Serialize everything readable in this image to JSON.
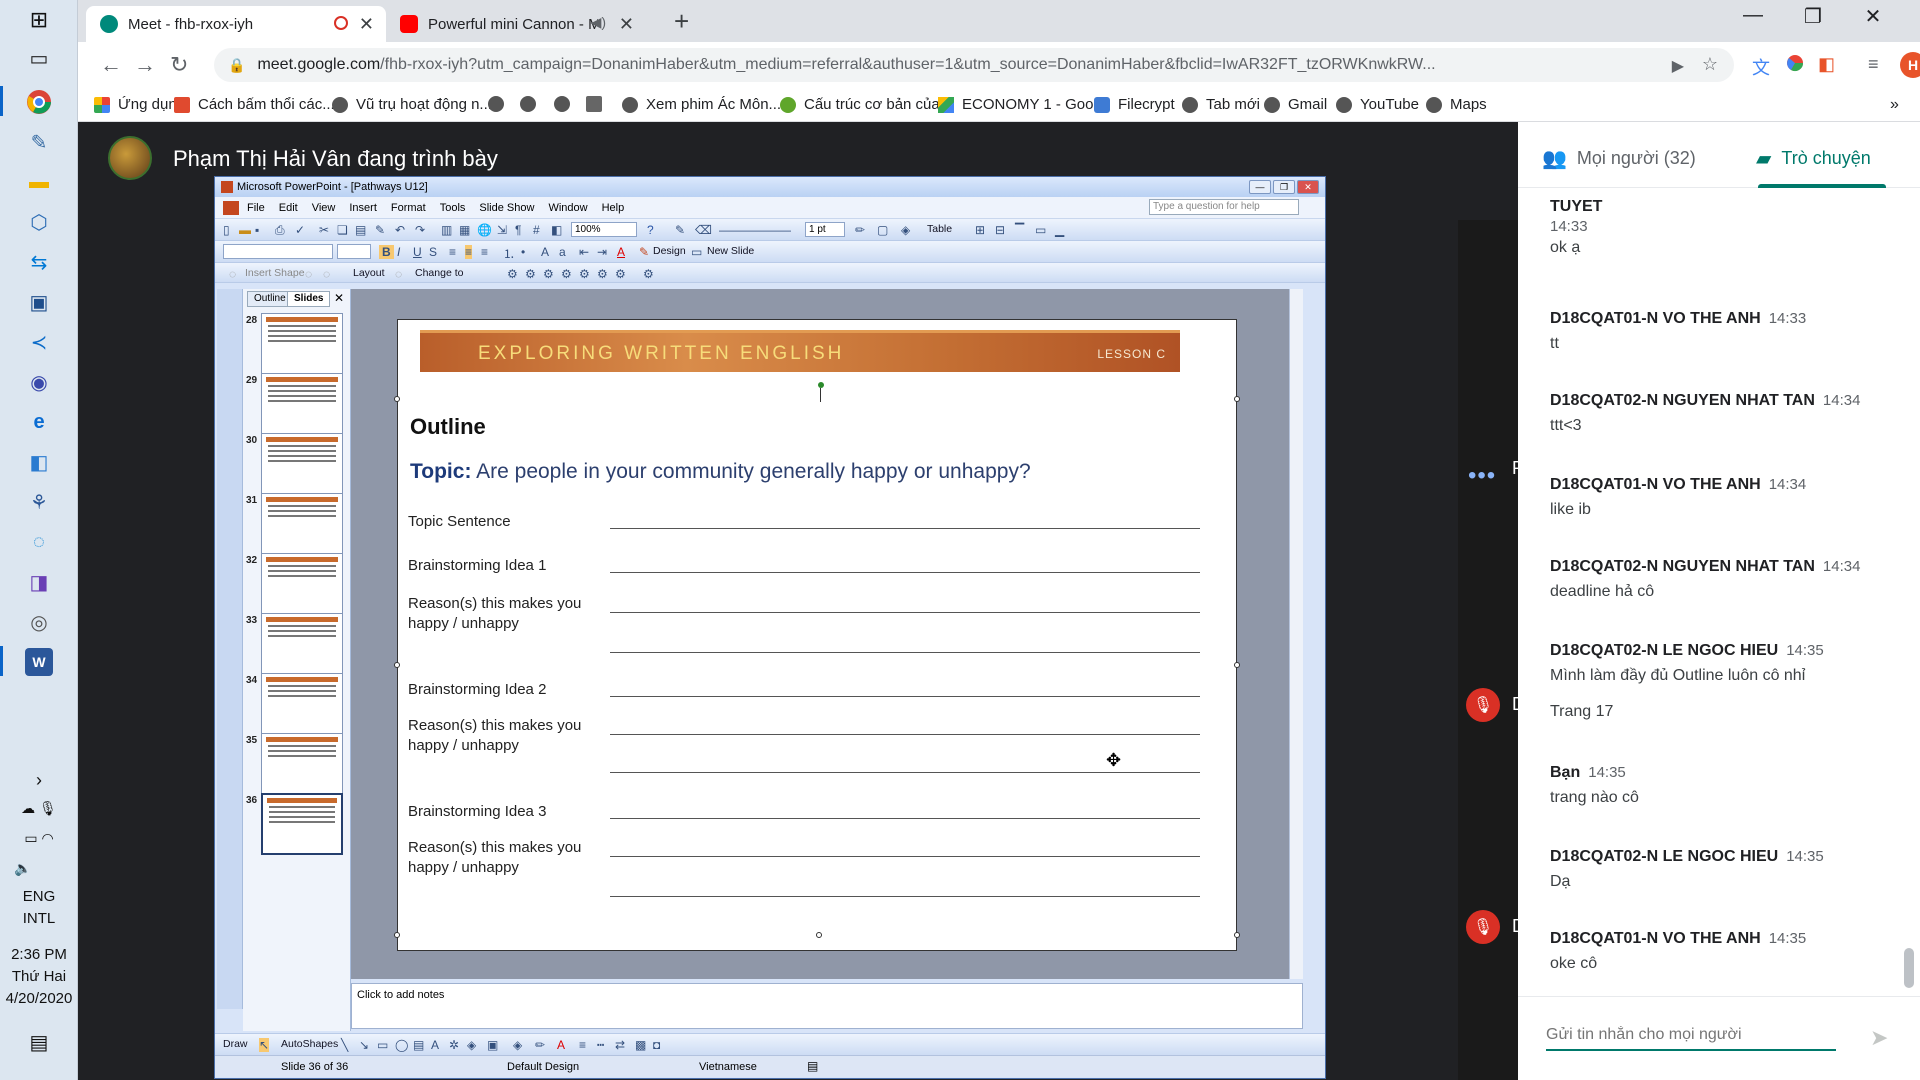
{
  "chrome": {
    "tabs": [
      {
        "title": "Meet - fhb-rxox-iyh",
        "active": true
      },
      {
        "title": "Powerful mini Cannon - Mak",
        "active": false
      }
    ],
    "new_tab": "+",
    "url_host": "meet.google.com",
    "url_rest": "/fhb-rxox-iyh?utm_campaign=DonanimHaber&utm_medium=referral&authuser=1&utm_source=DonanimHaber&fbclid=IwAR32FT_tzORWKnwkRW...",
    "avatar_letter": "H",
    "bookmarks": [
      "Ứng dụng",
      "Cách bấm thổi các...",
      "Vũ trụ hoạt động n...",
      "Xem phim Ác Môn...",
      "Cấu trúc cơ bản của...",
      "ECONOMY 1 - Goo...",
      "Filecrypt",
      "Tab mới",
      "Gmail",
      "YouTube",
      "Maps"
    ],
    "more_bookmarks": "»"
  },
  "taskbar": {
    "lang1": "ENG",
    "lang2": "INTL",
    "time": "2:36 PM",
    "day": "Thứ Hai",
    "date": "4/20/2020"
  },
  "meet": {
    "presenter_label": "Phạm Thị Hải Vân đang trình bày",
    "tile_letter_1": "P",
    "tile_letter_2": "D",
    "tile_letter_3": "D",
    "people_tab": "Mọi người (32)",
    "chat_tab": "Trò chuyện",
    "chat_placeholder": "Gửi tin nhắn cho mọi người",
    "messages": [
      {
        "who": "TUYET",
        "time": "14:33",
        "text": "ok ạ"
      },
      {
        "who": "D18CQAT01-N VO THE ANH",
        "time": "14:33",
        "text": "tt"
      },
      {
        "who": "D18CQAT02-N NGUYEN NHAT TAN",
        "time": "14:34",
        "text": "ttt<3"
      },
      {
        "who": "D18CQAT01-N VO THE ANH",
        "time": "14:34",
        "text": "like ib"
      },
      {
        "who": "D18CQAT02-N NGUYEN NHAT TAN",
        "time": "14:34",
        "text": "deadline hả cô"
      },
      {
        "who": "D18CQAT02-N LE NGOC HIEU",
        "time": "14:35",
        "text": "Mình làm đầy đủ Outline luôn cô nhỉ",
        "text2": "Trang 17"
      },
      {
        "who": "Bạn",
        "time": "14:35",
        "text": "trang nào cô"
      },
      {
        "who": "D18CQAT02-N LE NGOC HIEU",
        "time": "14:35",
        "text": "Dạ"
      },
      {
        "who": "D18CQAT01-N VO THE ANH",
        "time": "14:35",
        "text": "oke cô"
      }
    ]
  },
  "ppt": {
    "window_title": "Microsoft PowerPoint - [Pathways U12]",
    "menu": [
      "File",
      "Edit",
      "View",
      "Insert",
      "Format",
      "Tools",
      "Slide Show",
      "Window",
      "Help"
    ],
    "help_placeholder": "Type a question for help",
    "zoom": "100%",
    "line_weight": "1 pt",
    "table_label": "Table",
    "design_label": "Design",
    "new_slide_label": "New Slide",
    "insert_shape_label": "Insert Shape",
    "layout_label": "Layout",
    "change_to_label": "Change to",
    "pane_tab_outline": "Outline",
    "pane_tab_slides": "Slides",
    "slide_numbers": [
      "28",
      "29",
      "30",
      "31",
      "32",
      "33",
      "34",
      "35",
      "36"
    ],
    "notes_placeholder": "Click to add notes",
    "draw_label": "Draw",
    "autoshapes_label": "AutoShapes",
    "status_slide": "Slide 36 of 36",
    "status_design": "Default Design",
    "status_language": "Vietnamese",
    "slide": {
      "banner_title": "EXPLORING WRITTEN ENGLISH",
      "banner_lesson": "LESSON C",
      "outline_heading": "Outline",
      "topic_label": "Topic:",
      "topic_text": "Are people in your community generally happy or unhappy?",
      "rows": [
        "Topic Sentence",
        "Brainstorming Idea 1",
        "Reason(s) this makes you happy / unhappy",
        "Brainstorming Idea 2",
        "Reason(s) this makes you happy / unhappy",
        "Brainstorming Idea 3",
        "Reason(s) this makes you happy / unhappy"
      ]
    }
  }
}
